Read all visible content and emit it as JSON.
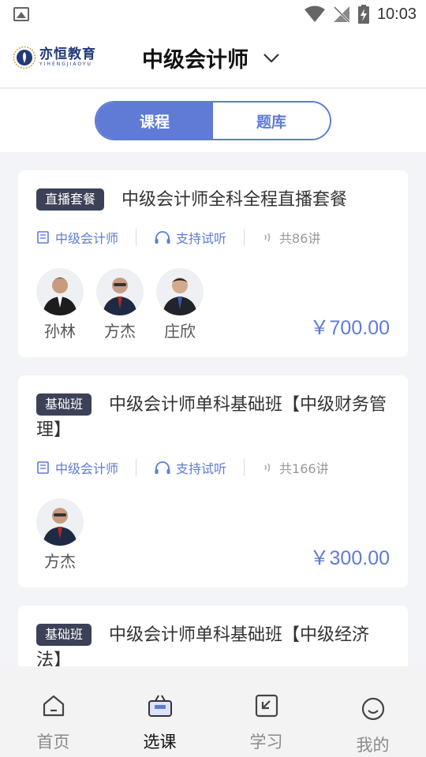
{
  "status_bar": {
    "time": "10:03"
  },
  "header": {
    "logo_cn": "亦恒教育",
    "logo_en": "YIHENGJIAOYU",
    "title": "中级会计师"
  },
  "segment": {
    "tabs": [
      "课程",
      "题库"
    ],
    "active_index": 0
  },
  "courses": [
    {
      "badge": "直播套餐",
      "title": "中级会计师全科全程直播套餐",
      "category": "中级会计师",
      "trial": "支持试听",
      "lessons": "共86讲",
      "teachers": [
        "孙林",
        "方杰",
        "庄欣"
      ],
      "price": "￥700.00"
    },
    {
      "badge": "基础班",
      "title": "中级会计师单科基础班【中级财务管理】",
      "category": "中级会计师",
      "trial": "支持试听",
      "lessons": "共166讲",
      "teachers": [
        "方杰"
      ],
      "price": "￥300.00"
    },
    {
      "badge": "基础班",
      "title": "中级会计师单科基础班【中级经济法】"
    }
  ],
  "tabbar": {
    "items": [
      "首页",
      "选课",
      "学习",
      "我的"
    ],
    "active_index": 1
  },
  "colors": {
    "accent": "#5f7bd6",
    "badge_bg": "#3c4157",
    "page_bg": "#f3f4f7"
  }
}
